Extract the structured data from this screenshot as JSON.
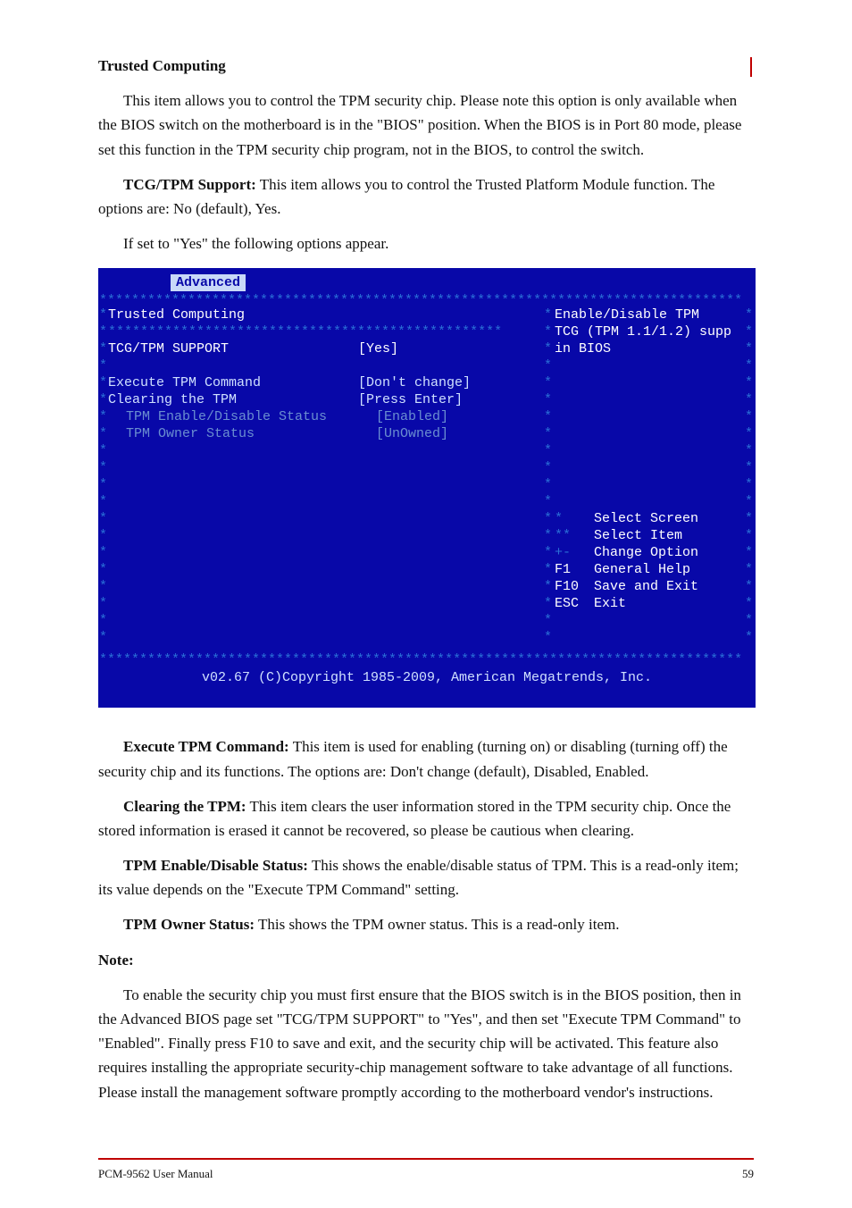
{
  "page": {
    "number": "59",
    "footer_model": "PCM-9562 User Manual"
  },
  "intro": {
    "heading": "Trusted Computing",
    "line1": "This item allows you to control the TPM security chip. Please note this option is only available when the BIOS switch on the motherboard is in the \"BIOS\" position. When the BIOS is in Port 80 mode, please set this function in the TPM security chip program, not in the BIOS, to control the switch.",
    "tcg_label": "TCG/TPM Support:",
    "tcg_text": "This item allows you to control the Trusted Platform Module function. The options are: No (default), Yes.",
    "yes_note": "If set to \"Yes\" the following options appear."
  },
  "bios": {
    "tab": "Advanced",
    "section": "Trusted Computing",
    "items": [
      {
        "label": "TCG/TPM SUPPORT",
        "value": "[Yes]"
      },
      {
        "label": "Execute TPM Command",
        "value": "[Don't change]"
      },
      {
        "label": "Clearing the TPM",
        "value": "[Press Enter]"
      },
      {
        "label": "TPM Enable/Disable Status",
        "value": "[Enabled]",
        "sub": true
      },
      {
        "label": "TPM Owner Status",
        "value": "[UnOwned]",
        "sub": true
      }
    ],
    "help": {
      "l1": "Enable/Disable TPM",
      "l2": "TCG (TPM 1.1/1.2) supp",
      "l3": "in BIOS"
    },
    "keys": [
      {
        "k": "*",
        "d": "Select Screen",
        "c": true
      },
      {
        "k": "**",
        "d": "Select Item",
        "c": true
      },
      {
        "k": "+-",
        "d": "Change Option",
        "c": true
      },
      {
        "k": "F1",
        "d": "General Help"
      },
      {
        "k": "F10",
        "d": "Save and Exit"
      },
      {
        "k": "ESC",
        "d": "Exit"
      }
    ],
    "footer": "v02.67 (C)Copyright 1985-2009, American Megatrends, Inc."
  },
  "notes": {
    "exec_label": "Execute TPM Command:",
    "exec_text": "This item is used for enabling (turning on) or disabling (turning off) the security chip and its functions. The options are: Don't change (default), Disabled, Enabled.",
    "clear_label": "Clearing the TPM:",
    "clear_text": "This item clears the user information stored in the TPM security chip. Once the stored information is erased it cannot be recovered, so please be cautious when clearing.",
    "status_label": "TPM Enable/Disable Status:",
    "status_text": "This shows the enable/disable status of TPM. This is a read-only item; its value depends on the \"Execute TPM Command\" setting.",
    "owner_label": "TPM Owner Status:",
    "owner_text": "This shows the TPM owner status. This is a read-only item.",
    "note_head": "Note:",
    "note_body": "To enable the security chip you must first ensure that the BIOS switch is in the BIOS position, then in the Advanced BIOS page set \"TCG/TPM SUPPORT\" to \"Yes\", and then set \"Execute TPM Command\" to \"Enabled\". Finally press F10 to save and exit, and the security chip will be activated. This feature also requires installing the appropriate security-chip management software to take advantage of all functions. Please install the management software promptly according to the motherboard vendor's instructions."
  }
}
